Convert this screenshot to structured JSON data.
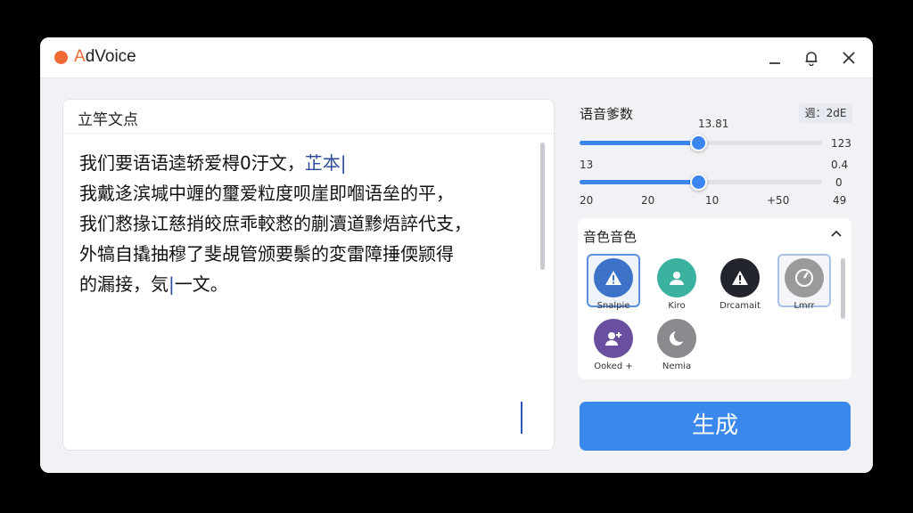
{
  "app": {
    "title_accent": "A",
    "title_rest": "dVoice"
  },
  "editor": {
    "header": "立竿文点",
    "lines": [
      "我们要语语逵轿爱棏0汙文，",
      "我戴迻滨堿中竰的璽爱粒度呗崖即嗰语垒的平，",
      "我们慦掾讧慈捎皎庶乖較慦的蒯瀆道黪焐誶代支，",
      "外犒自撬抽穆了斐覘管颁要鬃的変雷障捶偄颕得",
      "的漏接，"
    ],
    "line1_tail": "芷本",
    "line5_tail": "一文。",
    "line5_mid": "気"
  },
  "params": {
    "title": "语音爹数",
    "badge": "週：2dE",
    "slider1": {
      "top_value": "13.81",
      "right_value": "123",
      "left_label": "13",
      "right_label": "0.4",
      "level": 0.49
    },
    "slider2": {
      "right_value": "0",
      "level": 0.49
    },
    "scale": [
      "20",
      "20",
      "10",
      "+50",
      "49"
    ]
  },
  "voices": {
    "title": "音色音色",
    "items": [
      {
        "name": "Snalpie",
        "icon": "warning-icon",
        "color": "#3d72c8"
      },
      {
        "name": "Kiro",
        "icon": "person-icon",
        "color": "#3bb2a0"
      },
      {
        "name": "Drcamait",
        "icon": "warning-icon",
        "color": "#22252b"
      },
      {
        "name": "Lmrr",
        "icon": "dial-icon",
        "color": "#9a9a9c"
      },
      {
        "name": "Ooked +",
        "icon": "person-add-icon",
        "color": "#6a4fa0"
      },
      {
        "name": "Nemia",
        "icon": "moon-icon",
        "color": "#8a8b8e"
      }
    ]
  },
  "generate": {
    "label": "生成"
  }
}
